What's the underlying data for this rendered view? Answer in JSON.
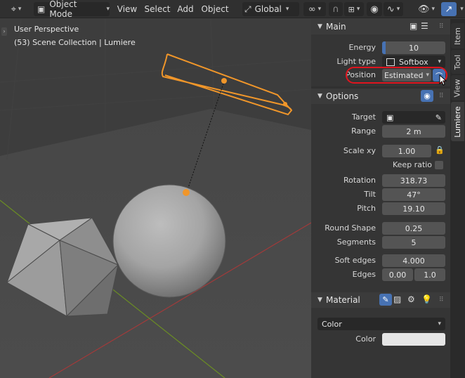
{
  "header": {
    "mode_label": "Object Mode",
    "menu": [
      "View",
      "Select",
      "Add",
      "Object"
    ],
    "transform_orientation": "Global"
  },
  "viewport": {
    "perspective_label": "User Perspective",
    "collection_label": "(53) Scene Collection | Lumiere"
  },
  "tabs": [
    "Item",
    "Tool",
    "View",
    "Lumiere"
  ],
  "main_panel": {
    "title": "Main",
    "energy_label": "Energy",
    "energy_value": "10",
    "energy_fill": 0.06,
    "light_type_label": "Light type",
    "light_type_value": "Softbox",
    "position_label": "Position",
    "position_value": "Estimated"
  },
  "options_panel": {
    "title": "Options",
    "target_label": "Target",
    "range_label": "Range",
    "range_value": "2 m",
    "scale_label": "Scale xy",
    "scale_value": "1.00",
    "keep_ratio_label": "Keep ratio",
    "rotation_label": "Rotation",
    "rotation_value": "318.73",
    "tilt_label": "Tilt",
    "tilt_value": "47°",
    "pitch_label": "Pitch",
    "pitch_value": "19.10",
    "round_shape_label": "Round Shape",
    "round_shape_value": "0.25",
    "segments_label": "Segments",
    "segments_value": "5",
    "soft_edges_label": "Soft edges",
    "soft_edges_value": "4.000",
    "edges_label": "Edges",
    "edges_value_1": "0.00",
    "edges_value_2": "1.0"
  },
  "material_panel": {
    "title": "Material",
    "dropdown_value": "Color",
    "color_label": "Color"
  },
  "colors": {
    "accent": "#4772b3",
    "selection_orange": "#f0962a",
    "highlight_red": "#e0141e"
  }
}
